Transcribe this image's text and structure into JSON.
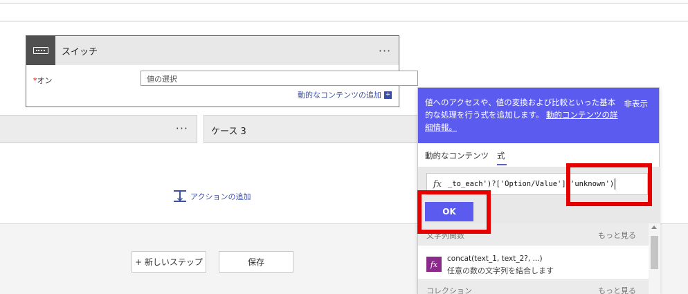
{
  "switch_card": {
    "title": "スイッチ",
    "more": "···",
    "on_required": "*",
    "on_label": "オン",
    "value_placeholder": "値の選択",
    "dynamic_link": "動的なコンテンツの追加",
    "dynamic_plus": "+"
  },
  "cases": {
    "left_more": "···",
    "right_title": "ケース 3"
  },
  "add_action": {
    "label": "アクションの追加"
  },
  "footer": {
    "new_step": "+ 新しいステップ",
    "save": "保存"
  },
  "panel": {
    "header_text": "値へのアクセスや、値の変換および比較といった基本的な処理を行う式を追加します。",
    "header_link": "動的コンテンツの詳細情報。",
    "hide": "非表示",
    "tabs": [
      {
        "label": "動的なコンテンツ"
      },
      {
        "label": "式"
      }
    ],
    "fx": "fx",
    "expression": "_to_each')?['Option/Value'],'unknown')",
    "ok": "OK",
    "sections": [
      {
        "title": "文字列関数",
        "more": "もっと見る"
      },
      {
        "title": "コレクション",
        "more": "もっと見る"
      }
    ],
    "function": {
      "icon": "fx",
      "name": "concat(text_1, text_2?, ...)",
      "desc": "任意の数の文字列を結合します"
    }
  },
  "colors": {
    "accent": "#5b5bf0",
    "link": "#3c4fa8",
    "highlight": "#e60000",
    "function_icon": "#8a2a8a"
  }
}
